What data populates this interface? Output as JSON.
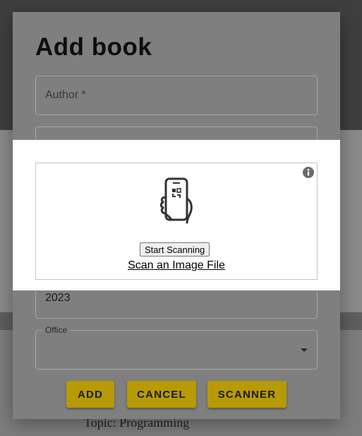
{
  "dialog": {
    "title": "Add book",
    "author_placeholder": "Author *",
    "year_value": "2023",
    "office_label": "Office",
    "buttons": {
      "add": "ADD",
      "cancel": "CANCEL",
      "scanner": "SCANNER"
    }
  },
  "scanner": {
    "start_button": "Start Scanning",
    "scan_file_link": "Scan an Image File",
    "icons": [
      "info-icon",
      "phone-qr-icon"
    ]
  },
  "background": {
    "topic_text": "Topic: Programming"
  },
  "colors": {
    "accent": "#b79a06",
    "overlay_bg": "#ffffff",
    "dim_dialog": "#7f7f7f"
  }
}
